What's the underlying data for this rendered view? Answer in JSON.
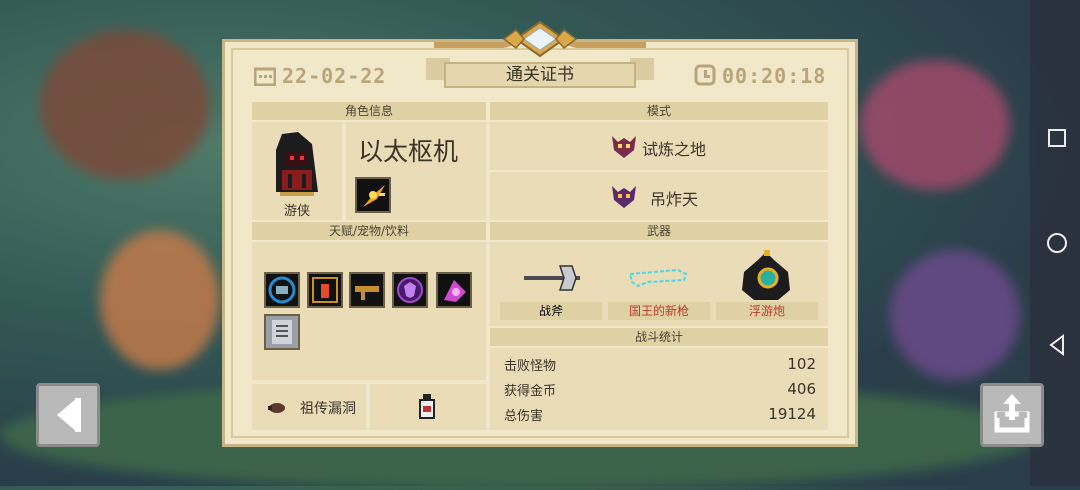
{
  "certificate": {
    "date": "22-02-22",
    "title": "通关证书",
    "time": "00:20:18"
  },
  "character": {
    "section_label": "角色信息",
    "job": "游侠",
    "name": "以太枢机"
  },
  "mode": {
    "section_label": "模式",
    "items": [
      "试炼之地",
      "吊炸天"
    ]
  },
  "extras": {
    "section_label": "天赋/宠物/饮料",
    "bug_label": "祖传漏洞"
  },
  "weapons": {
    "section_label": "武器",
    "items": [
      {
        "name": "战斧",
        "color": "#3c3428"
      },
      {
        "name": "国王的新枪",
        "color": "#c0392b"
      },
      {
        "name": "浮游炮",
        "color": "#c0392b"
      }
    ]
  },
  "stats": {
    "section_label": "战斗统计",
    "rows": [
      {
        "label": "击败怪物",
        "value": "102"
      },
      {
        "label": "获得金币",
        "value": "406"
      },
      {
        "label": "总伤害",
        "value": "19124"
      }
    ]
  },
  "colors": {
    "paper": "#f1e7c9",
    "panel": "#e9dcb6",
    "header": "#e0d1a5",
    "red_label": "#c0392b"
  }
}
